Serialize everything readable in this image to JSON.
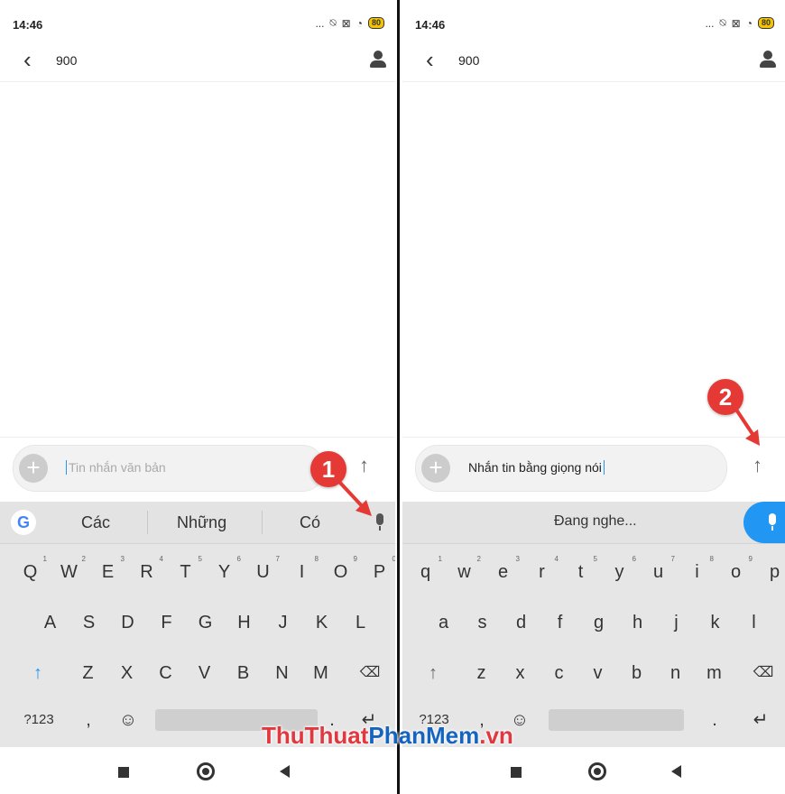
{
  "colors": {
    "accent_blue": "#2196f3",
    "badge_red": "#e53935",
    "watermark_red": "#e0383e",
    "watermark_blue": "#1565c0"
  },
  "left": {
    "status": {
      "time": "14:46",
      "icons": "...",
      "battery": "80"
    },
    "header": {
      "back_icon": "chevron-left-icon",
      "contact": "900",
      "contact_icon": "person-icon"
    },
    "compose": {
      "placeholder": "Tin nhắn văn bản",
      "value": "",
      "add_icon": "plus-icon",
      "send_icon": "arrow-up-icon"
    },
    "suggestions": [
      "Các",
      "Những",
      "Có"
    ],
    "keyboard": {
      "row1": [
        {
          "k": "Q",
          "n": "1"
        },
        {
          "k": "W",
          "n": "2"
        },
        {
          "k": "E",
          "n": "3"
        },
        {
          "k": "R",
          "n": "4"
        },
        {
          "k": "T",
          "n": "5"
        },
        {
          "k": "Y",
          "n": "6"
        },
        {
          "k": "U",
          "n": "7"
        },
        {
          "k": "I",
          "n": "8"
        },
        {
          "k": "O",
          "n": "9"
        },
        {
          "k": "P",
          "n": "0"
        }
      ],
      "row2": [
        "A",
        "S",
        "D",
        "F",
        "G",
        "H",
        "J",
        "K",
        "L"
      ],
      "row3": [
        "Z",
        "X",
        "C",
        "V",
        "B",
        "N",
        "M"
      ],
      "mode_key": "?123",
      "comma": ",",
      "period": ".",
      "enter": "↵"
    },
    "callout_number": "1"
  },
  "right": {
    "status": {
      "time": "14:46",
      "icons": "...",
      "battery": "80"
    },
    "header": {
      "contact": "900"
    },
    "compose": {
      "value": "Nhắn tin bằng giọng nói"
    },
    "listening": "Đang nghe...",
    "keyboard": {
      "row1": [
        {
          "k": "q",
          "n": "1"
        },
        {
          "k": "w",
          "n": "2"
        },
        {
          "k": "e",
          "n": "3"
        },
        {
          "k": "r",
          "n": "4"
        },
        {
          "k": "t",
          "n": "5"
        },
        {
          "k": "y",
          "n": "6"
        },
        {
          "k": "u",
          "n": "7"
        },
        {
          "k": "i",
          "n": "8"
        },
        {
          "k": "o",
          "n": "9"
        },
        {
          "k": "p",
          "n": "0"
        }
      ],
      "row2": [
        "a",
        "s",
        "d",
        "f",
        "g",
        "h",
        "j",
        "k",
        "l"
      ],
      "row3": [
        "z",
        "x",
        "c",
        "v",
        "b",
        "n",
        "m"
      ],
      "mode_key": "?123",
      "comma": ",",
      "period": ".",
      "enter": "↵"
    },
    "callout_number": "2"
  },
  "watermark": {
    "part1": "ThuThuat",
    "part2": "PhanMem",
    "part3": ".vn"
  }
}
